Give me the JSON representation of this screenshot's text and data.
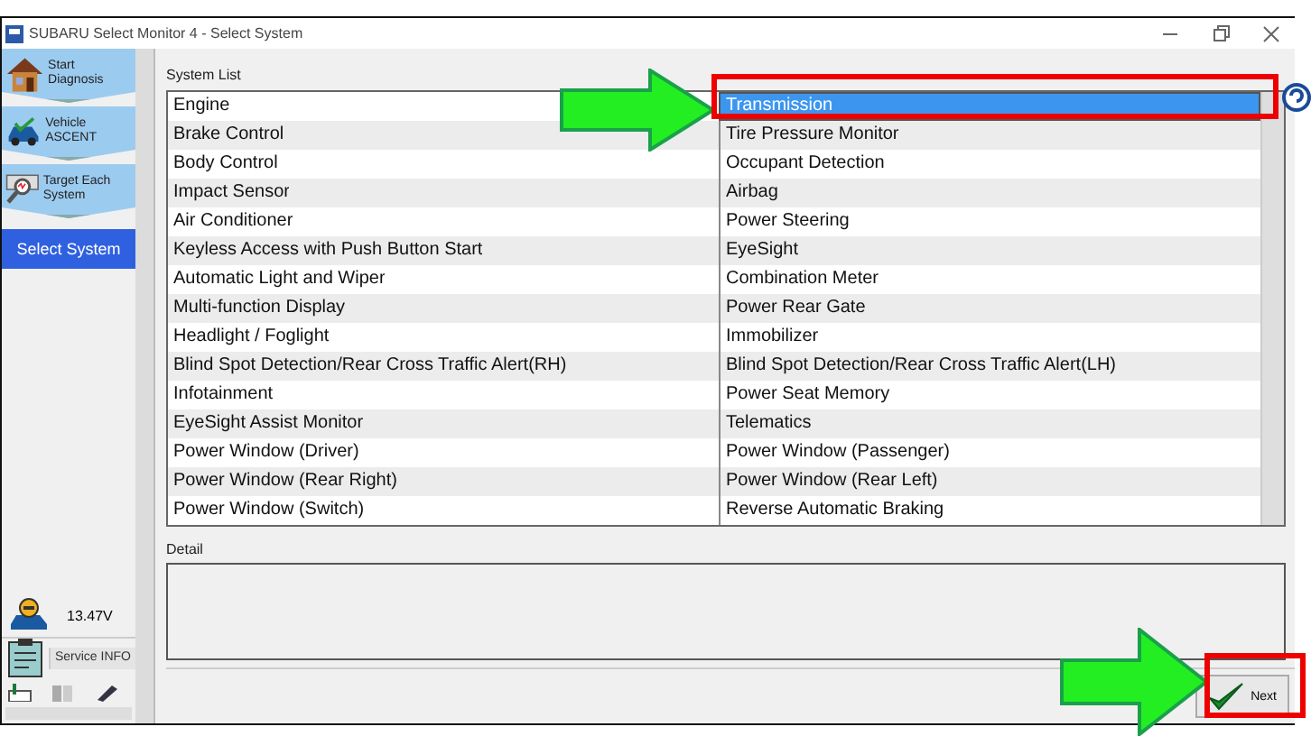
{
  "window": {
    "title": "SUBARU Select Monitor 4 - Select System"
  },
  "sidebar": {
    "items": [
      {
        "label": "Start Diagnosis",
        "kind": "house",
        "selected": false
      },
      {
        "label": "Vehicle ASCENT",
        "kind": "car",
        "selected": false
      },
      {
        "label": "Target Each System",
        "kind": "scope",
        "selected": false
      },
      {
        "label": "Select System",
        "kind": "plain",
        "selected": true
      }
    ],
    "voltage": "13.47V",
    "service_button": "Service INFO"
  },
  "system_list": {
    "title": "System List",
    "rows": [
      [
        {
          "label": "Engine",
          "selected": false
        },
        {
          "label": "Transmission",
          "selected": true
        }
      ],
      [
        {
          "label": "Brake Control",
          "selected": false
        },
        {
          "label": "Tire Pressure Monitor",
          "selected": false
        }
      ],
      [
        {
          "label": "Body Control",
          "selected": false
        },
        {
          "label": "Occupant Detection",
          "selected": false
        }
      ],
      [
        {
          "label": "Impact Sensor",
          "selected": false
        },
        {
          "label": "Airbag",
          "selected": false
        }
      ],
      [
        {
          "label": "Air Conditioner",
          "selected": false
        },
        {
          "label": "Power Steering",
          "selected": false
        }
      ],
      [
        {
          "label": "Keyless Access with Push Button Start",
          "selected": false
        },
        {
          "label": "EyeSight",
          "selected": false
        }
      ],
      [
        {
          "label": "Automatic Light and Wiper",
          "selected": false
        },
        {
          "label": "Combination Meter",
          "selected": false
        }
      ],
      [
        {
          "label": "Multi-function Display",
          "selected": false
        },
        {
          "label": "Power Rear Gate",
          "selected": false
        }
      ],
      [
        {
          "label": "Headlight / Foglight",
          "selected": false
        },
        {
          "label": "Immobilizer",
          "selected": false
        }
      ],
      [
        {
          "label": "Blind Spot Detection/Rear Cross Traffic Alert(RH)",
          "selected": false
        },
        {
          "label": "Blind Spot Detection/Rear Cross Traffic Alert(LH)",
          "selected": false
        }
      ],
      [
        {
          "label": "Infotainment",
          "selected": false
        },
        {
          "label": "Power Seat Memory",
          "selected": false
        }
      ],
      [
        {
          "label": "EyeSight Assist Monitor",
          "selected": false
        },
        {
          "label": "Telematics",
          "selected": false
        }
      ],
      [
        {
          "label": "Power Window (Driver)",
          "selected": false
        },
        {
          "label": "Power Window (Passenger)",
          "selected": false
        }
      ],
      [
        {
          "label": "Power Window (Rear Right)",
          "selected": false
        },
        {
          "label": "Power Window (Rear Left)",
          "selected": false
        }
      ],
      [
        {
          "label": "Power Window (Switch)",
          "selected": false
        },
        {
          "label": "Reverse Automatic Braking",
          "selected": false
        }
      ]
    ]
  },
  "detail": {
    "title": "Detail"
  },
  "next_button": "Next"
}
